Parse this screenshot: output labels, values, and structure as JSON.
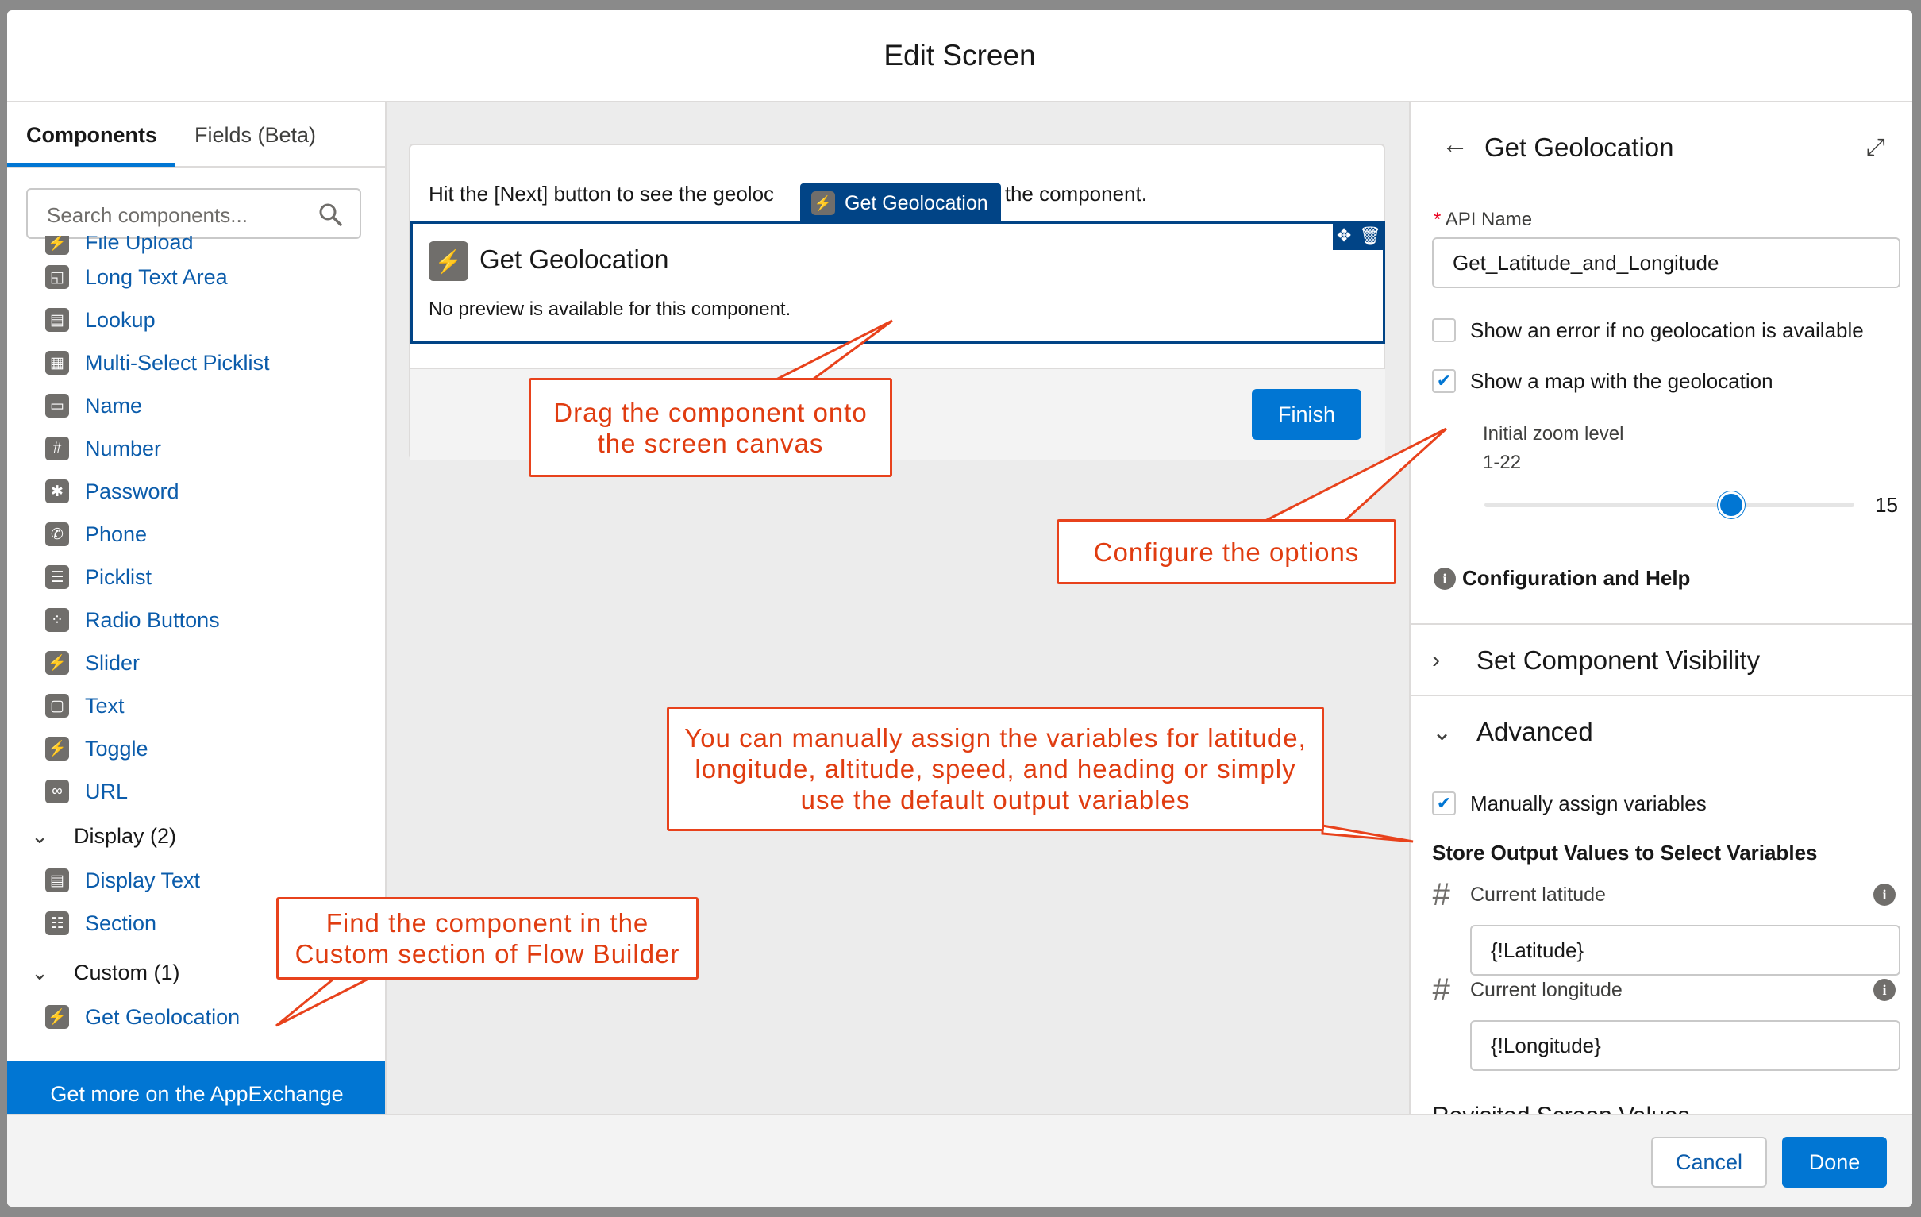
{
  "modal": {
    "title": "Edit Screen"
  },
  "left_panel": {
    "tabs": [
      "Components",
      "Fields (Beta)"
    ],
    "search_placeholder": "Search components...",
    "input_items": [
      "File Upload",
      "Long Text Area",
      "Lookup",
      "Multi-Select Picklist",
      "Name",
      "Number",
      "Password",
      "Phone",
      "Picklist",
      "Radio Buttons",
      "Slider",
      "Text",
      "Toggle",
      "URL"
    ],
    "display_section": {
      "label": "Display (2)",
      "items": [
        "Display Text",
        "Section"
      ]
    },
    "custom_section": {
      "label": "Custom (1)",
      "items": [
        "Get Geolocation"
      ]
    },
    "appexchange_label": "Get more on the AppExchange"
  },
  "canvas": {
    "hint_text": "Hit the [Next] button to see the geoloc",
    "hint_text_tail": "by the component.",
    "floating_label": "Get Geolocation",
    "component_name": "Get Geolocation",
    "no_preview": "No preview is available for this component.",
    "finish_label": "Finish"
  },
  "right_panel": {
    "title": "Get Geolocation",
    "api_name_label": "API Name",
    "api_name_value": "Get_Latitude_and_Longitude",
    "checkbox_error": {
      "label": "Show an error if no geolocation is available",
      "checked": false
    },
    "checkbox_map": {
      "label": "Show a map with the geolocation",
      "checked": true
    },
    "zoom_label": "Initial zoom level",
    "zoom_range": "1-22",
    "zoom_value": "15",
    "zoom_min": 1,
    "zoom_max": 22,
    "config_help": "Configuration and Help",
    "visibility_section": "Set Component Visibility",
    "advanced_section": "Advanced",
    "manual_assign": {
      "label": "Manually assign variables",
      "checked": true
    },
    "store_output_label": "Store Output Values to Select Variables",
    "latitude_label": "Current latitude",
    "latitude_value": "{!Latitude}",
    "longitude_label": "Current longitude",
    "longitude_value": "{!Longitude}",
    "revisited_label": "Revisited Screen Values"
  },
  "footer": {
    "cancel_label": "Cancel",
    "done_label": "Done"
  },
  "callouts": {
    "drag": [
      "Drag the component onto",
      "the screen canvas"
    ],
    "configure": [
      "Configure the options"
    ],
    "manual": [
      "You can manually assign the variables for latitude,",
      "longitude, altitude, speed, and heading or simply",
      "use the default output variables"
    ],
    "find": [
      "Find the component in the",
      "Custom section of Flow Builder"
    ]
  },
  "colors": {
    "brand": "#0176d3",
    "brand_dark": "#014486",
    "callout": "#e8421c"
  }
}
